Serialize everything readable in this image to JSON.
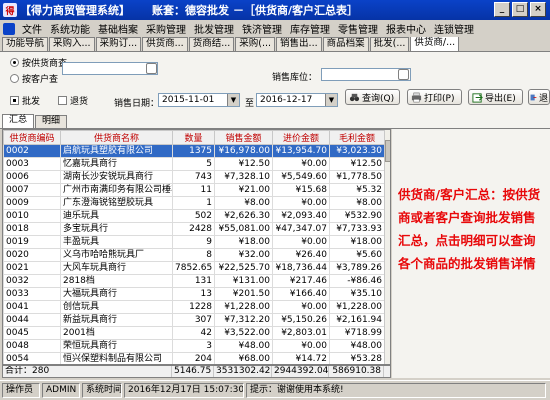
{
  "window": {
    "title": "【得力商贸管理系统】",
    "account": "账套：德容批发",
    "active_window": "－［供货商/客户汇总表］",
    "buttons": [
      "_",
      "□",
      "×"
    ]
  },
  "menu": [
    "文件",
    "系统功能",
    "基础档案",
    "采购管理",
    "批发管理",
    "铁济管理",
    "库存管理",
    "零售管理",
    "报表中心",
    "连锁管理"
  ],
  "page_tabs": [
    "功能导航",
    "采购入...",
    "采购订...",
    "供货商...",
    "货商结...",
    "采购(...",
    "销售出...",
    "商品档案",
    "批发(...",
    "供货商/..."
  ],
  "filter": {
    "radio_supplier": "按供货商查",
    "radio_customer": "按客户查",
    "supplier_value": "",
    "customer_value": "",
    "warehouse_label": "销售库位：",
    "warehouse_value": "",
    "check_wholesale": "批发",
    "check_return": "退货",
    "date_label": "销售日期：",
    "date_from": "2015-11-01",
    "date_to_label": "至",
    "date_to": "2016-12-17",
    "btn_query": "查询(Q)",
    "btn_print": "打印(P)",
    "btn_export": "导出(E)",
    "btn_exit": "退"
  },
  "sub_tabs": [
    "汇总",
    "明细"
  ],
  "grid": {
    "columns": [
      "供货商编码",
      "供货商名称",
      "数量",
      "销售金额",
      "进价金额",
      "毛利金额"
    ],
    "rows": [
      [
        "0002",
        "启航玩具塑胶有限公司",
        "1375",
        "¥16,978.00",
        "¥13,954.70",
        "¥3,023.30"
      ],
      [
        "0003",
        "忆嘉玩具商行",
        "5",
        "¥12.50",
        "¥0.00",
        "¥12.50"
      ],
      [
        "0006",
        "湖南长沙安锐玩具商行",
        "743",
        "¥7,328.10",
        "¥5,549.60",
        "¥1,778.50"
      ],
      [
        "0007",
        "广州市南满印务有限公司棰丰工艺",
        "11",
        "¥21.00",
        "¥15.68",
        "¥5.32"
      ],
      [
        "0009",
        "广东澄海锐铭塑胶玩具",
        "1",
        "¥8.00",
        "¥0.00",
        "¥8.00"
      ],
      [
        "0010",
        "迪乐玩具",
        "502",
        "¥2,626.30",
        "¥2,093.40",
        "¥532.90"
      ],
      [
        "0018",
        "多宝玩具行",
        "2428",
        "¥55,081.00",
        "¥47,347.07",
        "¥7,733.93"
      ],
      [
        "0019",
        "丰盈玩具",
        "9",
        "¥18.00",
        "¥0.00",
        "¥18.00"
      ],
      [
        "0020",
        "义乌市哈哈熊玩具厂",
        "8",
        "¥32.00",
        "¥26.40",
        "¥5.60"
      ],
      [
        "0021",
        "大风车玩具商行",
        "7852.65",
        "¥22,525.70",
        "¥18,736.44",
        "¥3,789.26"
      ],
      [
        "0032",
        "2818档",
        "131",
        "¥131.00",
        "¥217.46",
        "-¥86.46"
      ],
      [
        "0033",
        "大福玩具商行",
        "13",
        "¥201.50",
        "¥166.40",
        "¥35.10"
      ],
      [
        "0041",
        "创信玩具",
        "1228",
        "¥1,228.00",
        "¥0.00",
        "¥1,228.00"
      ],
      [
        "0044",
        "新益玩具商行",
        "307",
        "¥7,312.20",
        "¥5,150.26",
        "¥2,161.94"
      ],
      [
        "0045",
        "2001档",
        "42",
        "¥3,522.00",
        "¥2,803.01",
        "¥718.99"
      ],
      [
        "0048",
        "荣恒玩具商行",
        "3",
        "¥48.00",
        "¥0.00",
        "¥48.00"
      ],
      [
        "0054",
        "恒兴保塑料制品有限公司",
        "204",
        "¥68.00",
        "¥14.72",
        "¥53.28"
      ],
      [
        "0056",
        "澄海乐飞玩具",
        "1",
        "¥249.00",
        "¥180.50",
        "¥68.50"
      ]
    ]
  },
  "totals": {
    "label": "合计：280",
    "qty": "5146.75",
    "sales": "3531302.42",
    "cost": "2944392.04",
    "profit": "586910.38"
  },
  "annotation": "供货商/客户汇总：按供货商或者客户查询批发销售汇总，点击明细可以查询各个商品的批发销售详情",
  "status": {
    "operator_label": "操作员",
    "operator": "ADMIN",
    "sys_time_label": "系统时间",
    "sys_time": "2016年12月17日 15:07:30",
    "hint": "提示：谢谢使用本系统!"
  },
  "colors": {
    "title_bar": "#0a42c8",
    "header_text": "#c00000",
    "selected_row": "#316ac5",
    "annotation_text": "#e8080a"
  }
}
